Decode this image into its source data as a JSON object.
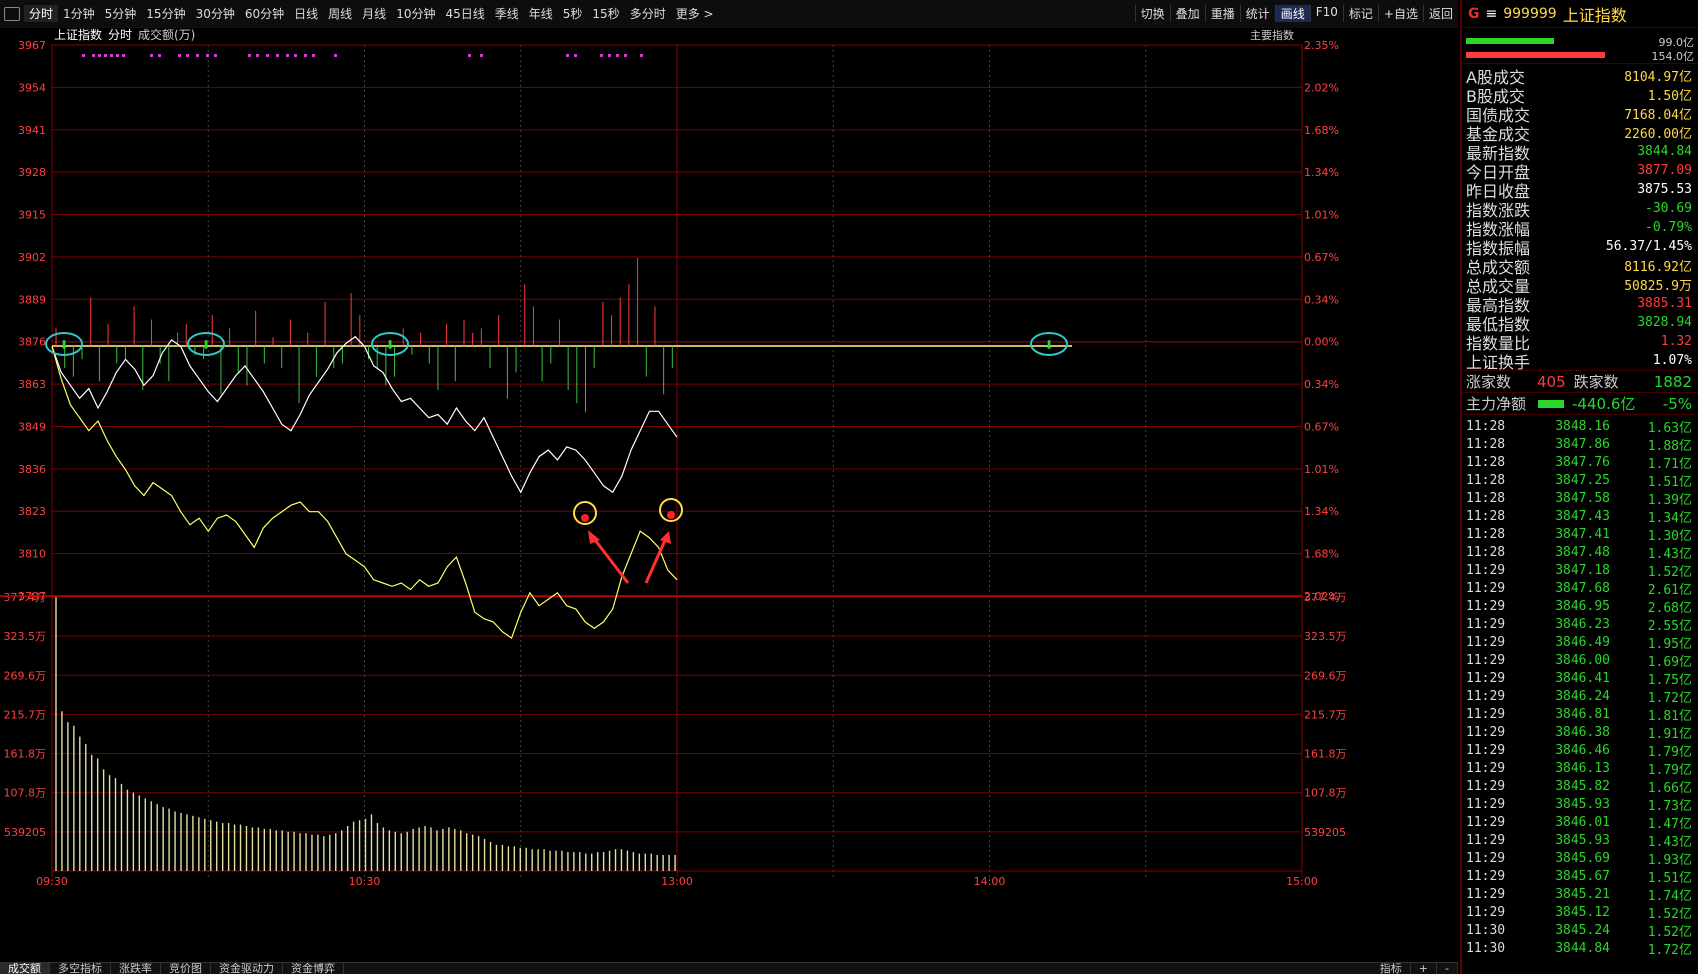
{
  "toolbar": {
    "left": [
      "分时",
      "1分钟",
      "5分钟",
      "15分钟",
      "30分钟",
      "60分钟",
      "日线",
      "周线",
      "月线",
      "10分钟",
      "45日线",
      "季线",
      "年线",
      "5秒",
      "15秒",
      "多分时",
      "更多 >"
    ],
    "right": [
      "切换",
      "叠加",
      "重播",
      "统计",
      "画线",
      "F10",
      "标记",
      "+自选",
      "返回"
    ]
  },
  "chart_header": {
    "index_name": "上证指数",
    "mode": "分时",
    "volume_label": "成交额(万)",
    "main_index_button": "主要指数"
  },
  "bottom_tabs": [
    "成交额",
    "多空指标",
    "涨跌率",
    "竞价图",
    "资金驱动力",
    "资金博弈"
  ],
  "bottom_right": [
    "指标",
    "+",
    "-"
  ],
  "chart_data": {
    "type": "line",
    "price_axis": {
      "ylim": [
        3797,
        3967
      ],
      "ticks": [
        3967,
        3954,
        3941,
        3928,
        3915,
        3902,
        3889,
        3876,
        3863,
        3849,
        3836,
        3823,
        3810,
        3797
      ],
      "prev_close": 3876
    },
    "pct_axis": {
      "ticks": [
        "2.35%",
        "2.02%",
        "1.68%",
        "1.34%",
        "1.01%",
        "0.67%",
        "0.34%",
        "0.00%",
        "0.34%",
        "0.67%",
        "1.01%",
        "1.34%",
        "1.68%",
        "2.02%"
      ]
    },
    "volume_axis": {
      "ticks_left": [
        "377.4万",
        "323.5万",
        "269.6万",
        "215.7万",
        "161.8万",
        "107.8万",
        "539205"
      ],
      "ticks_right": [
        "377.4万",
        "323.5万",
        "269.6万",
        "215.7万",
        "161.8万",
        "107.8万",
        "539205"
      ],
      "ylim": [
        0,
        377.4
      ]
    },
    "time_axis": {
      "labels": [
        "09:30",
        "10:30",
        "13:00",
        "14:00",
        "15:00"
      ],
      "sessions_minutes": 240
    },
    "series": [
      {
        "color": "#ffffff",
        "values": [
          3874,
          3866,
          3862,
          3858,
          3861,
          3855,
          3860,
          3866,
          3870,
          3867,
          3862,
          3865,
          3872,
          3876,
          3874,
          3868,
          3864,
          3860,
          3857,
          3861,
          3865,
          3868,
          3864,
          3860,
          3855,
          3850,
          3848,
          3853,
          3859,
          3863,
          3867,
          3872,
          3875,
          3877,
          3874,
          3868,
          3866,
          3861,
          3857,
          3858,
          3855,
          3852,
          3853,
          3850,
          3855,
          3851,
          3848,
          3852,
          3846,
          3840,
          3834,
          3829,
          3835,
          3840,
          3842,
          3839,
          3843,
          3842,
          3839,
          3835,
          3831,
          3829,
          3834,
          3842,
          3848,
          3854,
          3854,
          3850,
          3846
        ]
      },
      {
        "color": "#ffff66",
        "values": [
          3874,
          3864,
          3856,
          3852,
          3848,
          3851,
          3845,
          3840,
          3836,
          3831,
          3828,
          3832,
          3830,
          3828,
          3823,
          3819,
          3821,
          3817,
          3821,
          3822,
          3820,
          3816,
          3812,
          3818,
          3821,
          3823,
          3825,
          3826,
          3823,
          3823,
          3820,
          3815,
          3810,
          3808,
          3806,
          3802,
          3801,
          3800,
          3801,
          3799,
          3802,
          3800,
          3801,
          3806,
          3809,
          3801,
          3792,
          3790,
          3789,
          3786,
          3784,
          3792,
          3798,
          3794,
          3796,
          3798,
          3794,
          3793,
          3789,
          3787,
          3789,
          3793,
          3803,
          3810,
          3817,
          3815,
          3812,
          3805,
          3802
        ]
      }
    ],
    "flow_bars_note": "red/green bars around prev-close line",
    "flow_bars": [
      8,
      -10,
      -14,
      -6,
      22,
      -16,
      10,
      -8,
      -6,
      18,
      -20,
      12,
      -8,
      -16,
      6,
      10,
      -4,
      -6,
      14,
      -22,
      8,
      -12,
      -18,
      16,
      -8,
      4,
      -10,
      12,
      -26,
      6,
      -14,
      20,
      -10,
      -8,
      24,
      14,
      -6,
      -10,
      -18,
      -14,
      8,
      -4,
      6,
      -8,
      -20,
      10,
      -16,
      12,
      6,
      8,
      -10,
      14,
      -24,
      -12,
      28,
      18,
      -16,
      -8,
      12,
      -20,
      -26,
      -30,
      -10,
      20,
      14,
      22,
      28,
      40,
      -14,
      18,
      -22,
      -10
    ],
    "volume": [
      377,
      220,
      205,
      200,
      185,
      175,
      160,
      155,
      140,
      132,
      128,
      120,
      112,
      108,
      104,
      100,
      96,
      92,
      88,
      86,
      82,
      80,
      78,
      76,
      74,
      72,
      70,
      68,
      66,
      66,
      64,
      64,
      62,
      60,
      60,
      58,
      58,
      56,
      56,
      54,
      54,
      52,
      52,
      50,
      50,
      48,
      50,
      52,
      56,
      62,
      68,
      70,
      72,
      78,
      66,
      60,
      56,
      54,
      52,
      54,
      58,
      60,
      62,
      60,
      56,
      58,
      60,
      58,
      56,
      52,
      50,
      48,
      44,
      40,
      36,
      36,
      34,
      34,
      32,
      32,
      30,
      30,
      30,
      28,
      28,
      28,
      26,
      26,
      26,
      24,
      24,
      26,
      26,
      28,
      30,
      30,
      28,
      26,
      24,
      24,
      24,
      22,
      22,
      22,
      22
    ]
  },
  "right_panel": {
    "header": {
      "flag": "G",
      "menu": "≡",
      "code": "999999",
      "name": "上证指数"
    },
    "ratio_bars": [
      {
        "label": "99.0亿",
        "color": "#2bd62b",
        "w": 0.42
      },
      {
        "label": "154.0亿",
        "color": "#ff3b3b",
        "w": 0.66
      }
    ],
    "stats": [
      {
        "k": "A股成交",
        "v": "8104.97亿",
        "c": "yellow"
      },
      {
        "k": "B股成交",
        "v": "1.50亿",
        "c": "yellow"
      },
      {
        "k": "国债成交",
        "v": "7168.04亿",
        "c": "yellow"
      },
      {
        "k": "基金成交",
        "v": "2260.00亿",
        "c": "yellow"
      },
      {
        "k": "最新指数",
        "v": "3844.84",
        "c": "green"
      },
      {
        "k": "今日开盘",
        "v": "3877.09",
        "c": "red"
      },
      {
        "k": "昨日收盘",
        "v": "3875.53",
        "c": "white"
      },
      {
        "k": "指数涨跌",
        "v": "-30.69",
        "c": "green"
      },
      {
        "k": "指数涨幅",
        "v": "-0.79%",
        "c": "green"
      },
      {
        "k": "指数振幅",
        "v": "56.37/1.45%",
        "c": "white"
      },
      {
        "k": "总成交额",
        "v": "8116.92亿",
        "c": "yellow"
      },
      {
        "k": "总成交量",
        "v": "50825.9万",
        "c": "yellow"
      },
      {
        "k": "最高指数",
        "v": "3885.31",
        "c": "red"
      },
      {
        "k": "最低指数",
        "v": "3828.94",
        "c": "green"
      },
      {
        "k": "指数量比",
        "v": "1.32",
        "c": "red"
      },
      {
        "k": "上证换手",
        "v": "1.07%",
        "c": "white"
      }
    ],
    "advance": {
      "up_label": "涨家数",
      "up": "405",
      "down_label": "跌家数",
      "down": "1882"
    },
    "flow": {
      "label": "主力净额",
      "value": "-440.6亿",
      "pct": "-5%"
    },
    "ticks": [
      [
        "11:28",
        "3848.16",
        "1.63亿"
      ],
      [
        "11:28",
        "3847.86",
        "1.88亿"
      ],
      [
        "11:28",
        "3847.76",
        "1.71亿"
      ],
      [
        "11:28",
        "3847.25",
        "1.51亿"
      ],
      [
        "11:28",
        "3847.58",
        "1.39亿"
      ],
      [
        "11:28",
        "3847.43",
        "1.34亿"
      ],
      [
        "11:28",
        "3847.41",
        "1.30亿"
      ],
      [
        "11:28",
        "3847.48",
        "1.43亿"
      ],
      [
        "11:29",
        "3847.18",
        "1.52亿"
      ],
      [
        "11:29",
        "3847.68",
        "2.61亿"
      ],
      [
        "11:29",
        "3846.95",
        "2.68亿"
      ],
      [
        "11:29",
        "3846.23",
        "2.55亿"
      ],
      [
        "11:29",
        "3846.49",
        "1.95亿"
      ],
      [
        "11:29",
        "3846.00",
        "1.69亿"
      ],
      [
        "11:29",
        "3846.41",
        "1.75亿"
      ],
      [
        "11:29",
        "3846.24",
        "1.72亿"
      ],
      [
        "11:29",
        "3846.81",
        "1.81亿"
      ],
      [
        "11:29",
        "3846.38",
        "1.91亿"
      ],
      [
        "11:29",
        "3846.46",
        "1.79亿"
      ],
      [
        "11:29",
        "3846.13",
        "1.79亿"
      ],
      [
        "11:29",
        "3845.82",
        "1.66亿"
      ],
      [
        "11:29",
        "3845.93",
        "1.73亿"
      ],
      [
        "11:29",
        "3846.01",
        "1.47亿"
      ],
      [
        "11:29",
        "3845.93",
        "1.43亿"
      ],
      [
        "11:29",
        "3845.69",
        "1.93亿"
      ],
      [
        "11:29",
        "3845.67",
        "1.51亿"
      ],
      [
        "11:29",
        "3845.21",
        "1.74亿"
      ],
      [
        "11:29",
        "3845.12",
        "1.52亿"
      ],
      [
        "11:30",
        "3845.24",
        "1.52亿"
      ],
      [
        "11:30",
        "3844.84",
        "1.72亿"
      ]
    ]
  }
}
